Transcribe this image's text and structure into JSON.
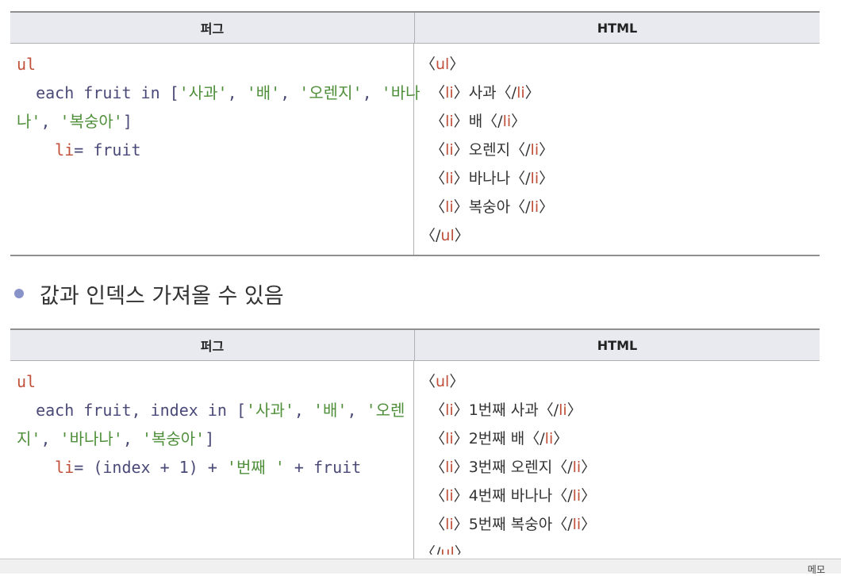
{
  "table1": {
    "header_left": "퍼그",
    "header_right": "HTML",
    "pug": {
      "l1_tag": "ul",
      "l2_kw": "each fruit in [",
      "l2_s1": "'사과'",
      "l2_c1": ", ",
      "l2_s2": "'배'",
      "l2_c2": ", ",
      "l2_s3": "'오렌지'",
      "l2_c3": ", ",
      "l2_s4a": "'바나",
      "l3_s4b": "나'",
      "l3_c4": ", ",
      "l3_s5": "'복숭아'",
      "l3_end": "]",
      "l4_tag": "li",
      "l4_rest": "= fruit"
    },
    "html": {
      "open_ul": "ul",
      "items": [
        "사과",
        "배",
        "오렌지",
        "바나나",
        "복숭아"
      ],
      "close_ul": "ul",
      "li": "li"
    }
  },
  "bullet": {
    "text": "값과 인덱스 가져올 수 있음"
  },
  "table2": {
    "header_left": "퍼그",
    "header_right": "HTML",
    "pug": {
      "l1_tag": "ul",
      "l2_kw": "each fruit, index in [",
      "l2_s1": "'사과'",
      "l2_c1": ", ",
      "l2_s2": "'배'",
      "l2_c2": ", ",
      "l2_s3a": "'오렌",
      "l3_s3b": "지'",
      "l3_c3": ", ",
      "l3_s4": "'바나나'",
      "l3_c4": ", ",
      "l3_s5": "'복숭아'",
      "l3_end": "]",
      "l4_tag": "li",
      "l4_mid": "= (index + 1) + ",
      "l4_str": "'번째 '",
      "l4_end": " + fruit"
    },
    "html": {
      "open_ul": "ul",
      "items": [
        "1번째 사과",
        "2번째 배",
        "3번째 오렌지",
        "4번째 바나나",
        "5번째 복숭아"
      ],
      "close_ul": "ul",
      "li": "li"
    }
  },
  "footer": {
    "memo": "메모"
  }
}
